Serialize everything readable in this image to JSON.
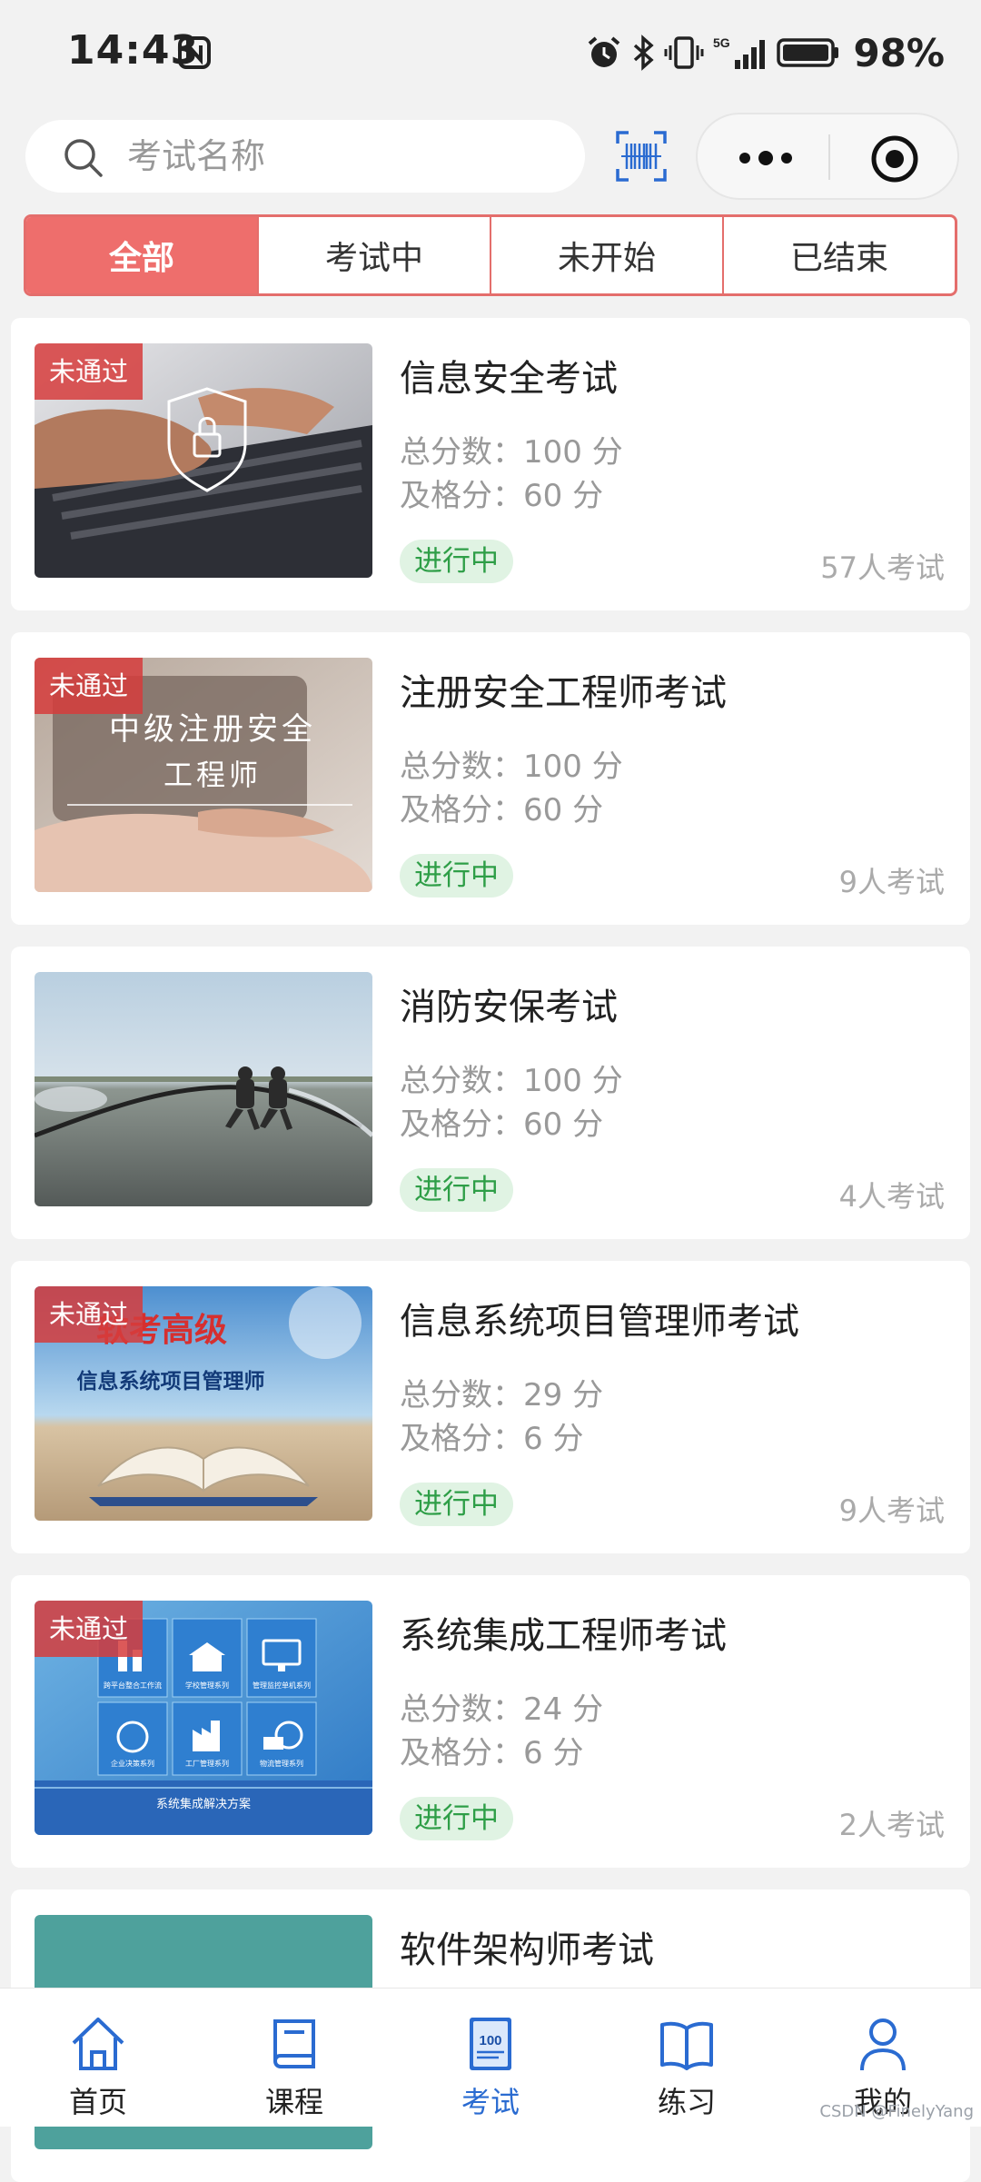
{
  "status_bar": {
    "time": "14:43",
    "battery": "98%",
    "network": "5G"
  },
  "search": {
    "placeholder": "考试名称",
    "value": ""
  },
  "tabs": [
    {
      "label": "全部",
      "active": true
    },
    {
      "label": "考试中",
      "active": false
    },
    {
      "label": "未开始",
      "active": false
    },
    {
      "label": "已结束",
      "active": false
    }
  ],
  "exams": [
    {
      "title": "信息安全考试",
      "total": "总分数：100 分",
      "pass": "及格分：60 分",
      "status": "进行中",
      "count": "57人考试",
      "badge": "未通过",
      "thumb_text": []
    },
    {
      "title": "注册安全工程师考试",
      "total": "总分数：100 分",
      "pass": "及格分：60 分",
      "status": "进行中",
      "count": "9人考试",
      "badge": "未通过",
      "thumb_text": [
        "中级注册安全",
        "工程师"
      ]
    },
    {
      "title": "消防安保考试",
      "total": "总分数：100 分",
      "pass": "及格分：60 分",
      "status": "进行中",
      "count": "4人考试",
      "badge": "",
      "thumb_text": []
    },
    {
      "title": "信息系统项目管理师考试",
      "total": "总分数：29 分",
      "pass": "及格分：6 分",
      "status": "进行中",
      "count": "9人考试",
      "badge": "未通过",
      "thumb_text": [
        "软考高级",
        "信息系统项目管理师"
      ]
    },
    {
      "title": "系统集成工程师考试",
      "total": "总分数：24 分",
      "pass": "及格分：6 分",
      "status": "进行中",
      "count": "2人考试",
      "badge": "未通过",
      "thumb_text": [
        "跨平台整合工作流",
        "学校管理系列",
        "管理监控单机系列",
        "企业决策系列",
        "工厂管理系列",
        "物流管理系列",
        "系统集成解决方案"
      ]
    },
    {
      "title": "软件架构师考试",
      "total": "",
      "pass": "",
      "status": "",
      "count": "",
      "badge": "",
      "thumb_text": []
    }
  ],
  "bottom_nav": [
    {
      "label": "首页",
      "icon": "home-icon",
      "active": false
    },
    {
      "label": "课程",
      "icon": "book-icon",
      "active": false
    },
    {
      "label": "考试",
      "icon": "exam-icon",
      "icon_text": "100",
      "active": true
    },
    {
      "label": "练习",
      "icon": "open-book-icon",
      "active": false
    },
    {
      "label": "我的",
      "icon": "user-icon",
      "active": false
    }
  ],
  "watermark": "CSDN @FinelyYang",
  "colors": {
    "accent": "#ee6e6c",
    "nav_active": "#2a6bd1",
    "status_green": "#2e9e47"
  }
}
